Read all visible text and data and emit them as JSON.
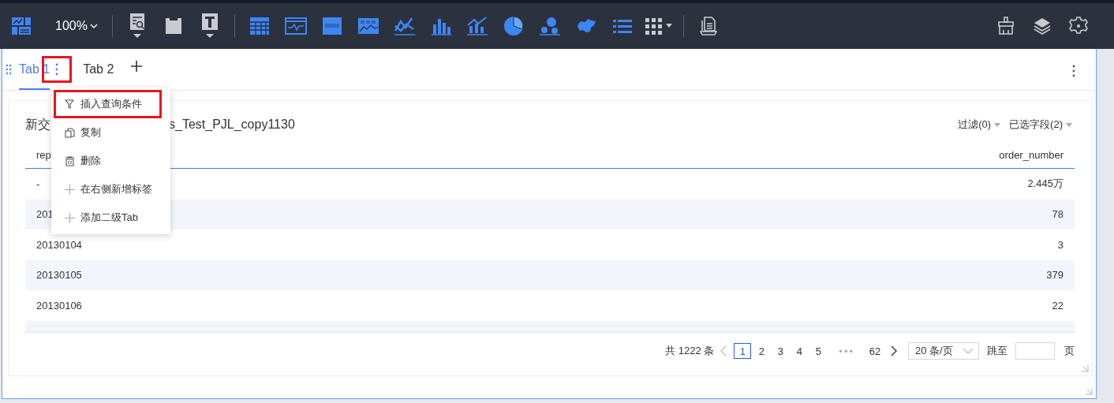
{
  "toolbar": {
    "zoom": "100%"
  },
  "tabs": [
    {
      "label": "Tab 1",
      "selected": true
    },
    {
      "label": "Tab 2",
      "selected": false
    }
  ],
  "tab_menu_button": {
    "highlighted": true
  },
  "card": {
    "title_start": "新交",
    "title_end": "s_Test_PJL_copy1130",
    "filter": "过滤(0)",
    "fields": "已选字段(2)",
    "columns": [
      "rep",
      "order_number"
    ],
    "rows": [
      {
        "date": "-",
        "value": "2.445万"
      },
      {
        "date": "201",
        "value": "78"
      },
      {
        "date": "20130104",
        "value": "3"
      },
      {
        "date": "20130105",
        "value": "379"
      },
      {
        "date": "20130106",
        "value": "22"
      }
    ],
    "pagination": {
      "total": "共 1222 条",
      "prev_disabled": true,
      "pages": [
        {
          "kind": "page",
          "label": "1",
          "selected": true
        },
        {
          "kind": "page",
          "label": "2",
          "selected": false
        },
        {
          "kind": "page",
          "label": "3",
          "selected": false
        },
        {
          "kind": "page",
          "label": "4",
          "selected": false
        },
        {
          "kind": "page",
          "label": "5",
          "selected": false
        },
        {
          "kind": "ellipsis",
          "label": "•••"
        },
        {
          "kind": "page",
          "label": "62",
          "selected": false
        }
      ],
      "page_size": "20 条/页",
      "jump_label": "跳至",
      "page_unit": "页"
    }
  },
  "menu": [
    {
      "kind": "filter",
      "label": "插入查询条件",
      "highlighted": true
    },
    {
      "kind": "copy",
      "label": "复制",
      "highlighted": false
    },
    {
      "kind": "delete",
      "label": "删除",
      "highlighted": false
    },
    {
      "kind": "add",
      "label": "在右侧新增标签",
      "highlighted": false
    },
    {
      "kind": "add",
      "label": "添加二级Tab",
      "highlighted": false
    }
  ]
}
